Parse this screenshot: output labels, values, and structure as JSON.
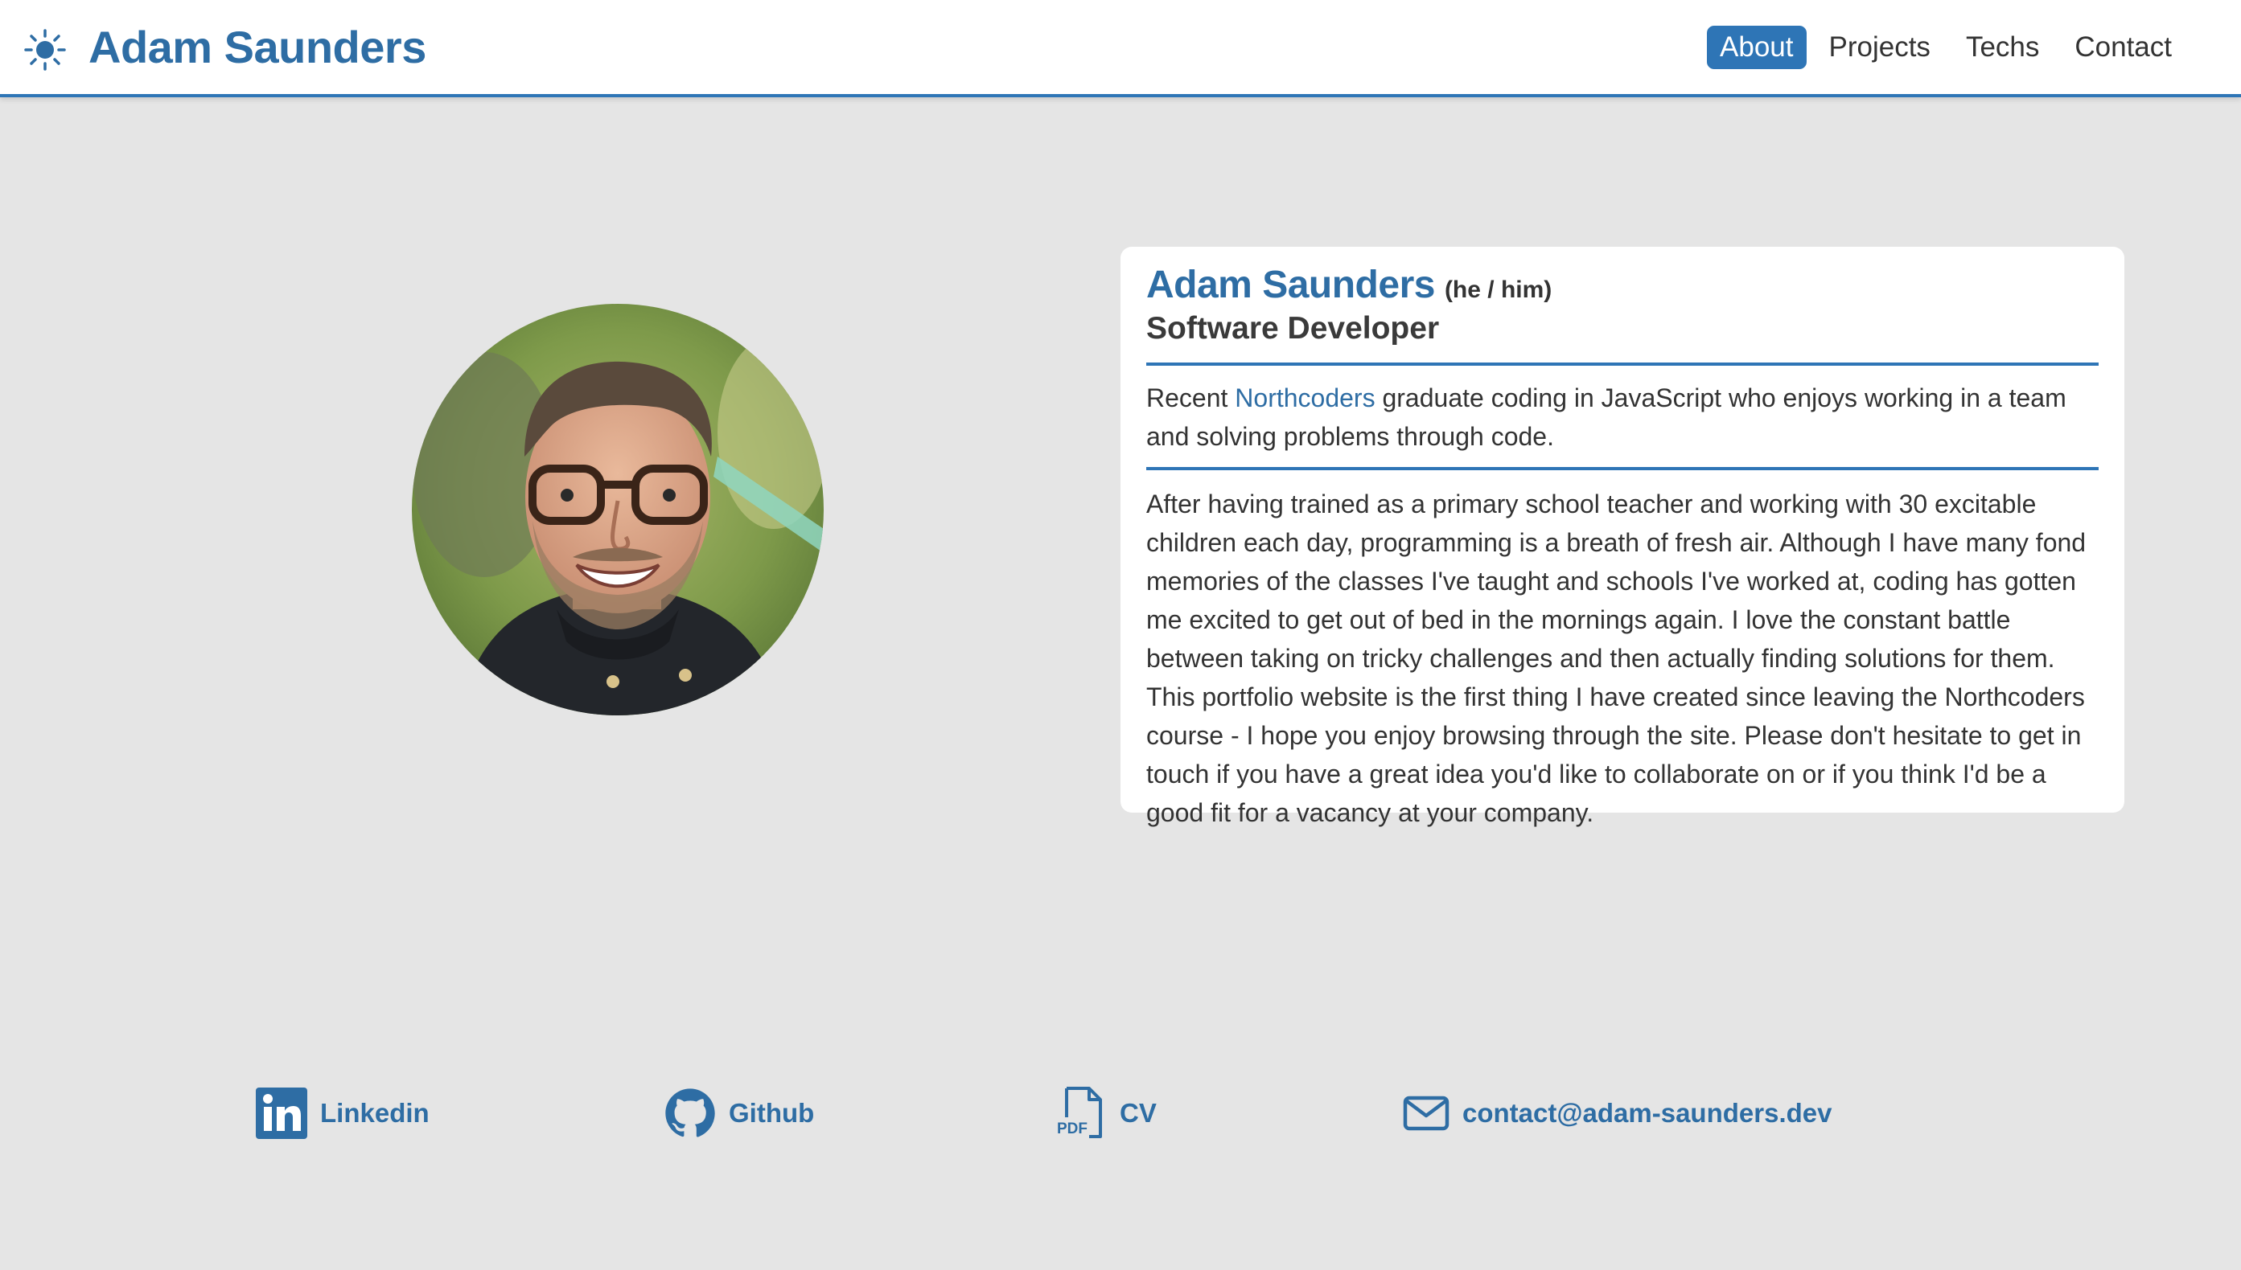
{
  "nav": {
    "theme_icon": "sun-icon",
    "brand": "Adam Saunders",
    "links": [
      "About",
      "Projects",
      "Techs",
      "Contact"
    ],
    "active": "About"
  },
  "profile": {
    "photo_icon": "profile-photo"
  },
  "about": {
    "name": "Adam Saunders",
    "pronouns": "(he / him)",
    "role": "Software Developer",
    "intro_prefix": "Recent ",
    "intro_link": "Northcoders",
    "intro_suffix": " graduate coding in JavaScript who enjoys working in a team and solving problems through code.",
    "bio": "After having trained as a primary school teacher and working with 30 excitable children each day, programming is a breath of fresh air. Although I have many fond memories of the classes I've taught and schools I've worked at, coding has gotten me excited to get out of bed in the mornings again. I love the constant battle between taking on tricky challenges and then actually finding solutions for them. This portfolio website is the first thing I have created since leaving the Northcoders course - I hope you enjoy browsing through the site. Please don't hesitate to get in touch if you have a great idea you'd like to collaborate on or if you think I'd be a good fit for a vacancy at your company."
  },
  "footer": {
    "linkedin": "Linkedin",
    "github": "Github",
    "cv": "CV",
    "cv_badge": "PDF",
    "email": "contact@adam-saunders.dev"
  },
  "colors": {
    "accent": "#2e75b6",
    "link": "#2e6da4",
    "background": "#e5e5e5",
    "card": "#ffffff"
  }
}
